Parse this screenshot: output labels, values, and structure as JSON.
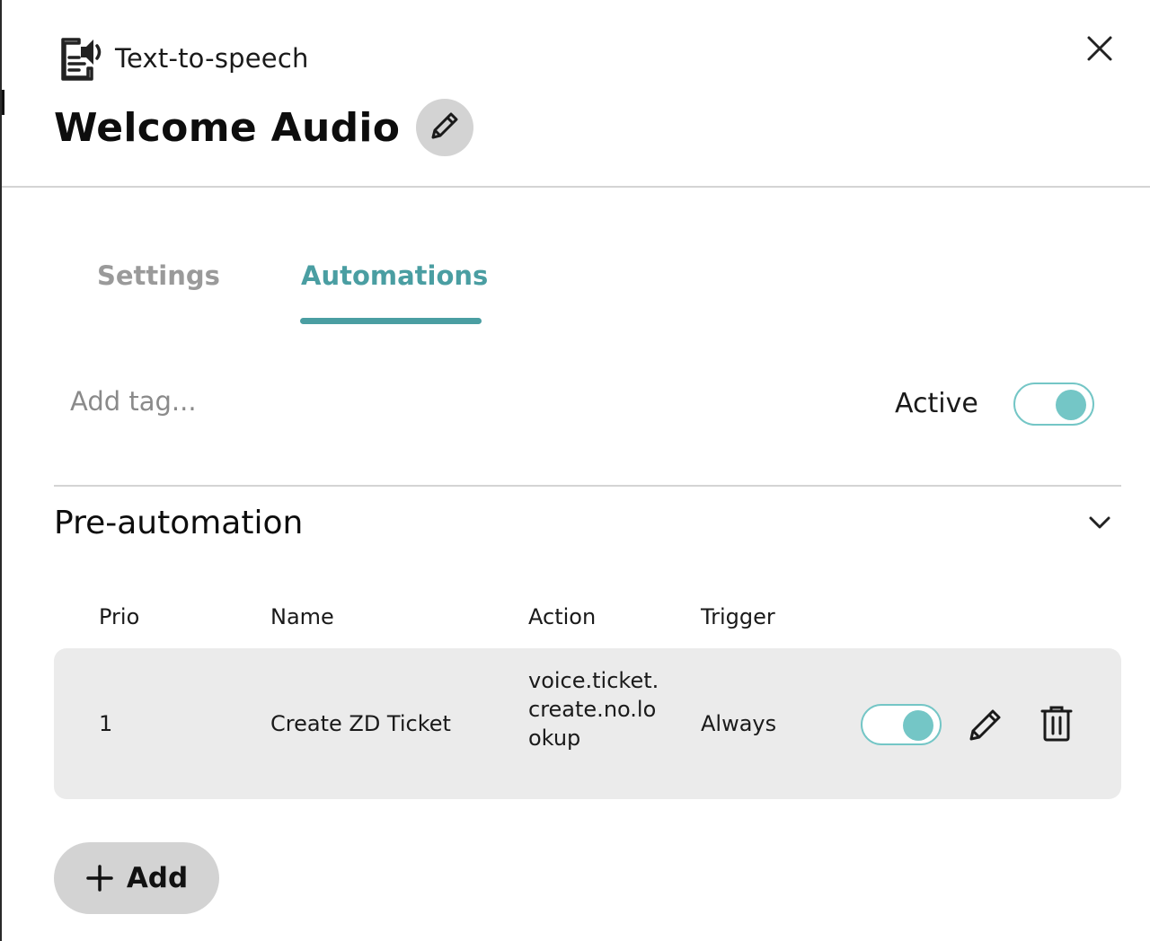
{
  "header": {
    "type_label": "Text-to-speech",
    "type_icon": "text-to-speech-icon",
    "title": "Welcome Audio",
    "edit_icon": "pencil-icon",
    "close_icon": "close-icon"
  },
  "tabs": [
    {
      "label": "Settings",
      "active": false
    },
    {
      "label": "Automations",
      "active": true
    }
  ],
  "tags": {
    "placeholder": "Add tag...",
    "value": ""
  },
  "active": {
    "label": "Active",
    "on": true
  },
  "section": {
    "title": "Pre-automation",
    "expanded": true,
    "chevron_icon": "chevron-down-icon",
    "columns": [
      "Prio",
      "Name",
      "Action",
      "Trigger"
    ],
    "rows": [
      {
        "prio": "1",
        "name": "Create ZD Ticket",
        "action": "voice.ticket.create.no.lookup",
        "trigger": "Always",
        "enabled": true
      }
    ]
  },
  "add_button": {
    "label": "Add",
    "icon": "plus-icon"
  },
  "colors": {
    "accent": "#4a9ea2",
    "toggle": "#74c6c6",
    "muted_tab": "#9a9a9a",
    "row_bg": "#ebebeb",
    "button_bg": "#d3d3d3"
  }
}
